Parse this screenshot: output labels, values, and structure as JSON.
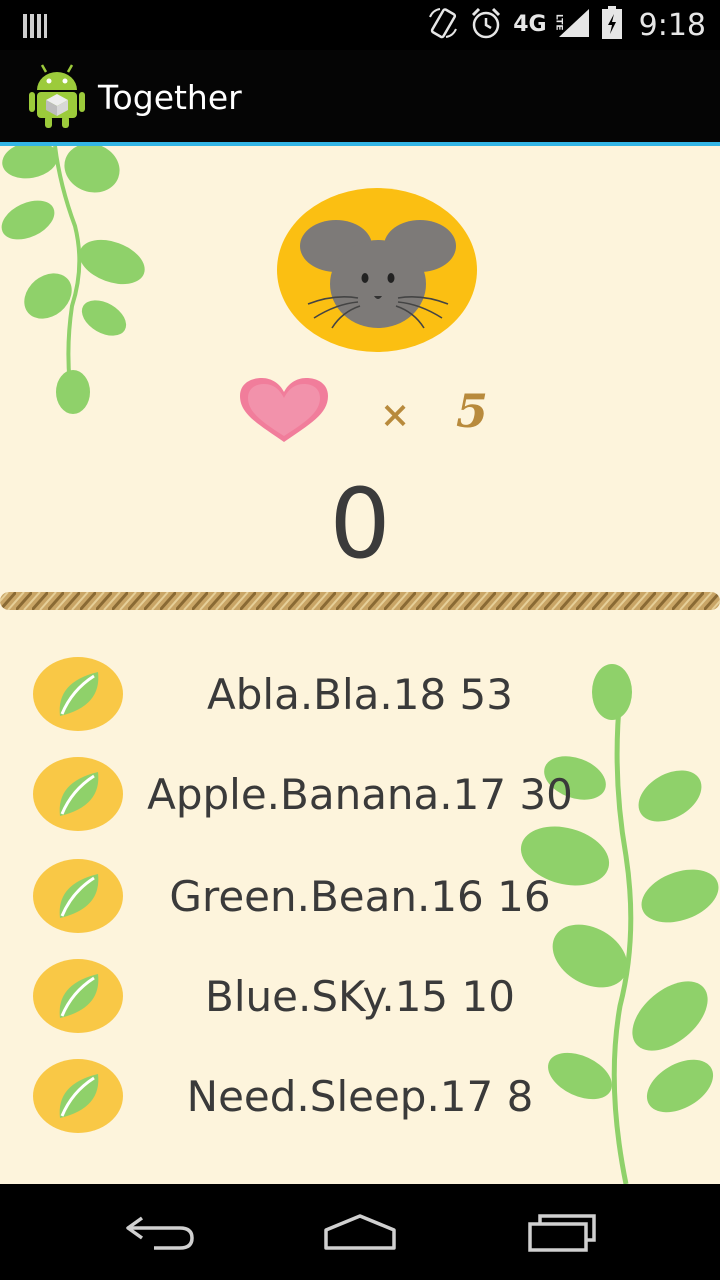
{
  "status_bar": {
    "time": "9:18",
    "network_type": "4G",
    "network_sub": "LTE"
  },
  "action_bar": {
    "title": "Together"
  },
  "game": {
    "lives_multiplier": "×",
    "lives_count": "5",
    "score": "0"
  },
  "list": {
    "items": [
      {
        "label": "Abla.Bla.18 53"
      },
      {
        "label": "Apple.Banana.17 30"
      },
      {
        "label": "Green.Bean.16 16"
      },
      {
        "label": "Blue.SKy.15 10"
      },
      {
        "label": "Need.Sleep.17 8"
      }
    ]
  },
  "colors": {
    "accent": "#33b5e5",
    "background": "#fdf4dc",
    "badge": "#f9c846",
    "leaf": "#8fd16a",
    "mouse_circle": "#fbbf12",
    "rope": "#c9a566"
  }
}
